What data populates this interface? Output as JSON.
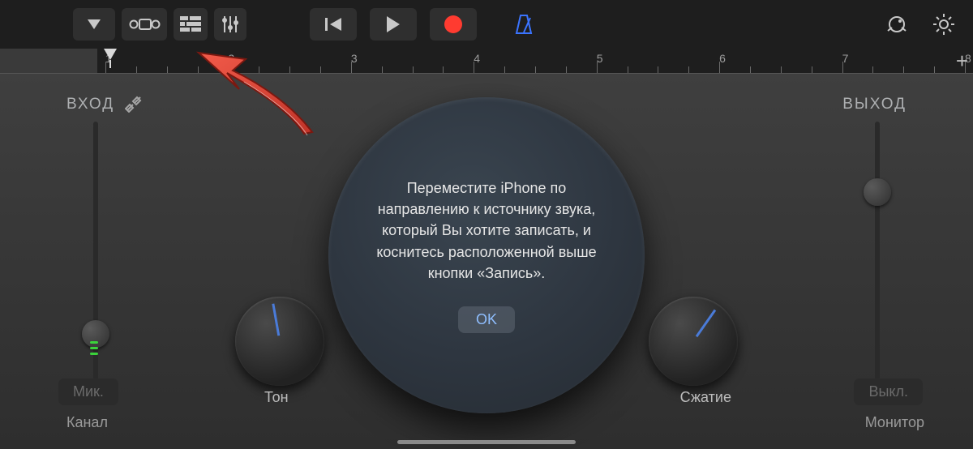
{
  "toolbar": {
    "icons": {
      "projects": "projects-menu",
      "loop_browser": "track-browser",
      "tracks_view": "tracks-view",
      "mixer": "mixer-controls",
      "prev": "go-to-start",
      "play": "play",
      "record": "record",
      "metronome": "metronome",
      "master_fx": "master-volume",
      "settings": "settings"
    }
  },
  "ruler": {
    "start": 1,
    "end": 8,
    "add_label": "+"
  },
  "input": {
    "label": "ВХОД",
    "channel_button": "Мик.",
    "channel_label": "Канал"
  },
  "output": {
    "label": "ВЫХОД",
    "toggle_button": "Выкл.",
    "monitor_label": "Монитор"
  },
  "knobs": {
    "tone_label": "Тон",
    "compression_label": "Сжатие"
  },
  "hint": {
    "text": "Переместите iPhone по направлению к источнику звука, который Вы хотите записать, и коснитесь расположенной выше кнопки «Запись».",
    "ok": "OK"
  }
}
